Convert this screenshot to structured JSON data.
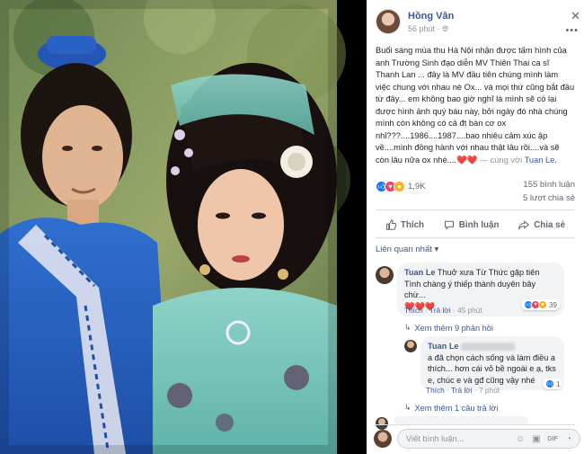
{
  "post": {
    "author": "Hồng Vân",
    "time": "56 phút ·",
    "privacy_icon": "globe-icon",
    "text_main": "Buổi sáng mùa thu Hà Nội nhận được tấm hình của anh Trường Sinh đạo diễn MV Thiên Thai ca sĩ Thanh Lan ... đây là MV đầu tiên chúng mình làm việc chung với nhau nè Ox... và mọi thứ cũng bắt đầu từ đây... em không bao giờ nghĩ là mình sẽ có lại được hình ảnh quý báu này, bởi ngày đó nhà chúng mình còn không có cả đt bàn cơ ox nhỉ???....1986....1987....bao nhiêu cảm xúc ập về....mình đồng hành với nhau thật lâu rồi....và sẽ còn lâu nữa ox nhé....",
    "text_hearts": "❤️❤️",
    "text_with": " — cùng với ",
    "text_tag": "Tuan Le",
    "text_end": "."
  },
  "stats": {
    "reactions": "1,9K",
    "comments": "155 bình luận",
    "shares": "5 lượt chia sẻ"
  },
  "actions": {
    "like": "Thích",
    "comment": "Bình luận",
    "share": "Chia sẻ"
  },
  "related_label": "Liên quan nhất ▾",
  "comments": [
    {
      "name": "Tuan Le",
      "text": " Thuở xưa Từ Thức gặp tiên Tình chàng ý thiếp thành duyên bây chừ...",
      "hearts": "❤️❤️❤️",
      "like": "Thích",
      "reply": "Trả lời",
      "time": "45 phút",
      "react_count": "39"
    },
    {
      "name": "Tuan Le",
      "text": "a đã chọn cách sống và làm điều a thích... hơn cái vỏ bề ngoài e ạ, tks e, chúc e và gđ cũng vậy nhé",
      "like": "Thích",
      "reply": "Trả lời",
      "time": "7 phút",
      "react_count": "1"
    }
  ],
  "see_more_replies": "Xem thêm 9 phản hồi",
  "see_more_reply": "Xem thêm 1 câu trả lời",
  "input": {
    "placeholder": "Viết bình luận..."
  },
  "colors": {
    "link": "#385898",
    "heart": "#e0245e",
    "like_blue": "#1877f2"
  }
}
